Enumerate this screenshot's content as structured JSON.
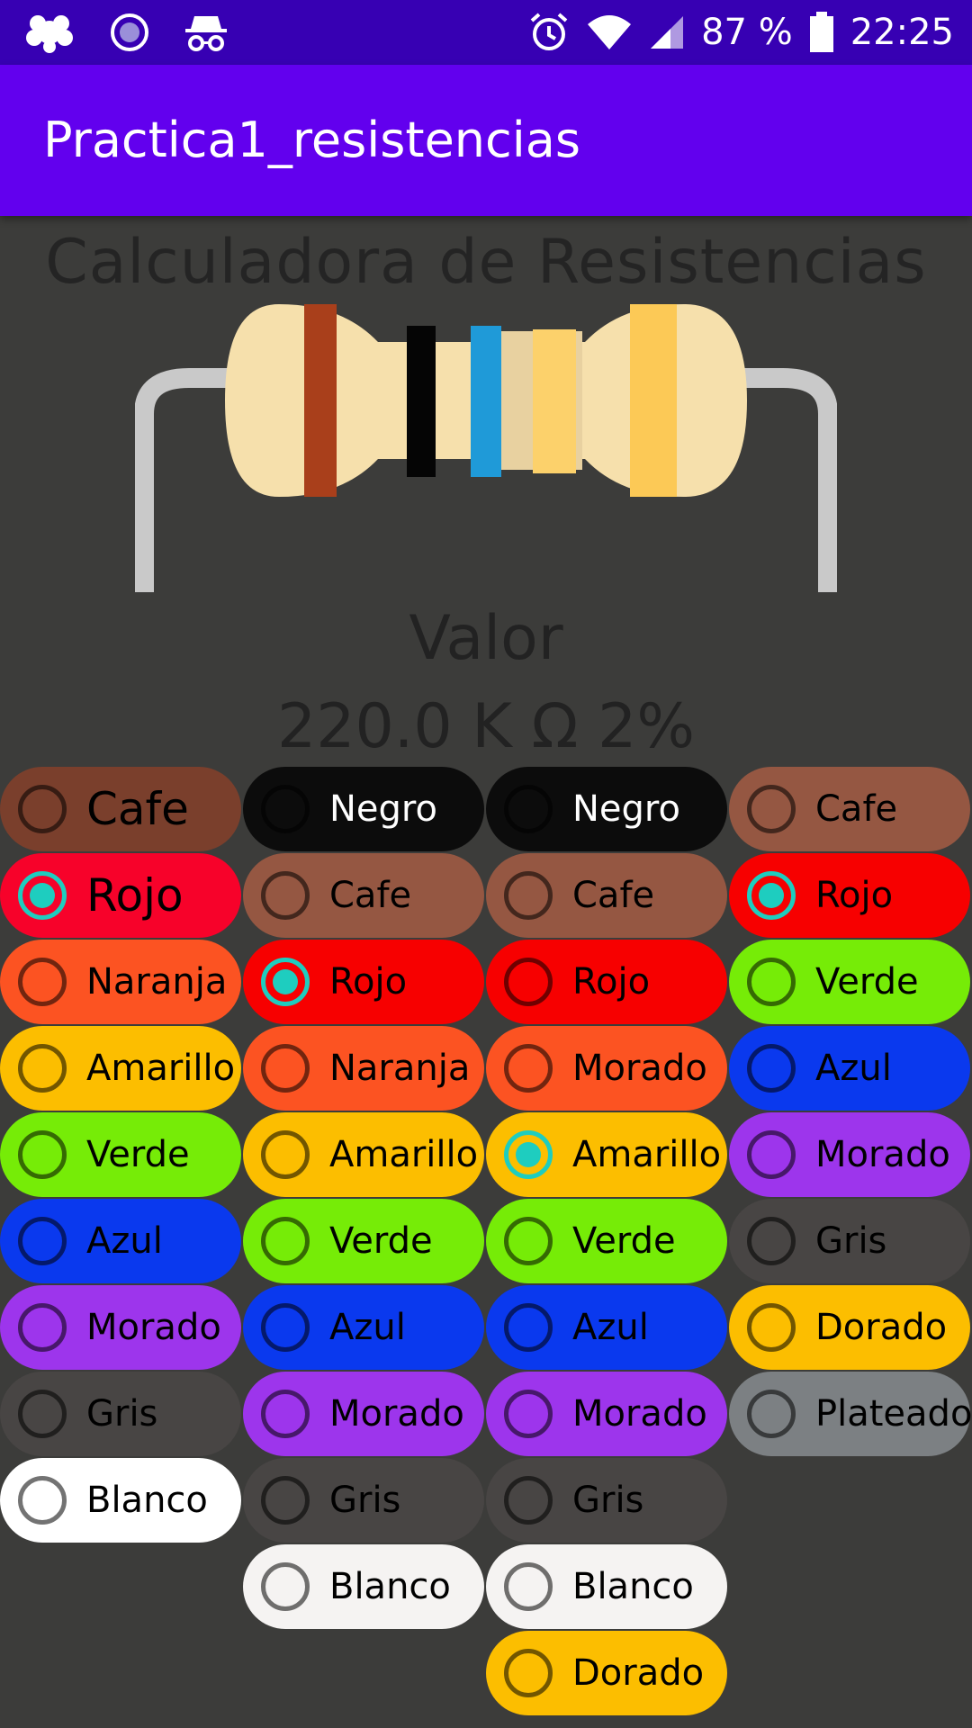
{
  "status": {
    "battery": "87 %",
    "time": "22:25"
  },
  "app_title": "Practica1_resistencias",
  "heading": "Calculadora de Resistencias",
  "valor_label": "Valor",
  "valor_value": "220.0 K Ω 2%",
  "columns": [
    {
      "name": "band1",
      "options": [
        {
          "label": "Cafe",
          "color": "#7a3f2c",
          "text": "#000",
          "checked": false
        },
        {
          "label": "Rojo",
          "color": "#f7022a",
          "text": "#000",
          "checked": true
        },
        {
          "label": "Naranja",
          "color": "#fc5322",
          "text": "#000",
          "checked": false
        },
        {
          "label": "Amarillo",
          "color": "#fcbe00",
          "text": "#000",
          "checked": false
        },
        {
          "label": "Verde",
          "color": "#76ec07",
          "text": "#000",
          "checked": false
        },
        {
          "label": "Azul",
          "color": "#0a39ee",
          "text": "#000",
          "checked": false
        },
        {
          "label": "Morado",
          "color": "#9d35ec",
          "text": "#000",
          "checked": false
        },
        {
          "label": "Gris",
          "color": "#484544",
          "text": "#000",
          "checked": false
        },
        {
          "label": "Blanco",
          "color": "#ffffff",
          "text": "#000",
          "checked": false
        }
      ]
    },
    {
      "name": "band2",
      "options": [
        {
          "label": "Negro",
          "color": "#0c0c0c",
          "text": "#fff",
          "checked": false
        },
        {
          "label": "Cafe",
          "color": "#955742",
          "text": "#000",
          "checked": false
        },
        {
          "label": "Rojo",
          "color": "#f70000",
          "text": "#000",
          "checked": true
        },
        {
          "label": "Naranja",
          "color": "#fc5322",
          "text": "#000",
          "checked": false
        },
        {
          "label": "Amarillo",
          "color": "#fcbe00",
          "text": "#000",
          "checked": false
        },
        {
          "label": "Verde",
          "color": "#76ec07",
          "text": "#000",
          "checked": false
        },
        {
          "label": "Azul",
          "color": "#0a39ee",
          "text": "#000",
          "checked": false
        },
        {
          "label": "Morado",
          "color": "#9d35ec",
          "text": "#000",
          "checked": false
        },
        {
          "label": "Gris",
          "color": "#484544",
          "text": "#000",
          "checked": false
        },
        {
          "label": "Blanco",
          "color": "#f5f3f2",
          "text": "#000",
          "checked": false
        }
      ]
    },
    {
      "name": "multiplier",
      "options": [
        {
          "label": "Negro",
          "color": "#0c0c0c",
          "text": "#fff",
          "checked": false
        },
        {
          "label": "Cafe",
          "color": "#955742",
          "text": "#000",
          "checked": false
        },
        {
          "label": "Rojo",
          "color": "#f70000",
          "text": "#000",
          "checked": false
        },
        {
          "label": "Morado",
          "color": "#fc5322",
          "text": "#000",
          "checked": false
        },
        {
          "label": "Amarillo",
          "color": "#fcbe00",
          "text": "#000",
          "checked": true
        },
        {
          "label": "Verde",
          "color": "#76ec07",
          "text": "#000",
          "checked": false
        },
        {
          "label": "Azul",
          "color": "#0a39ee",
          "text": "#000",
          "checked": false
        },
        {
          "label": "Morado",
          "color": "#9d35ec",
          "text": "#000",
          "checked": false
        },
        {
          "label": "Gris",
          "color": "#484544",
          "text": "#000",
          "checked": false
        },
        {
          "label": "Blanco",
          "color": "#f5f3f2",
          "text": "#000",
          "checked": false
        },
        {
          "label": "Dorado",
          "color": "#fcbe00",
          "text": "#000",
          "checked": false
        }
      ]
    },
    {
      "name": "tolerance",
      "options": [
        {
          "label": "Cafe",
          "color": "#955742",
          "text": "#000",
          "checked": false
        },
        {
          "label": "Rojo",
          "color": "#f70000",
          "text": "#000",
          "checked": true
        },
        {
          "label": "Verde",
          "color": "#76ec07",
          "text": "#000",
          "checked": false
        },
        {
          "label": "Azul",
          "color": "#0a39ee",
          "text": "#000",
          "checked": false
        },
        {
          "label": "Morado",
          "color": "#9d35ec",
          "text": "#000",
          "checked": false
        },
        {
          "label": "Gris",
          "color": "#484544",
          "text": "#000",
          "checked": false
        },
        {
          "label": "Dorado",
          "color": "#fcbe00",
          "text": "#000",
          "checked": false
        },
        {
          "label": "Plateado",
          "color": "#7c8083",
          "text": "#000",
          "checked": false
        }
      ]
    }
  ],
  "resistor_bands": [
    "#a93f1b",
    "#050505",
    "#1f9ad8",
    "#fcd16b",
    "#fcc956"
  ]
}
